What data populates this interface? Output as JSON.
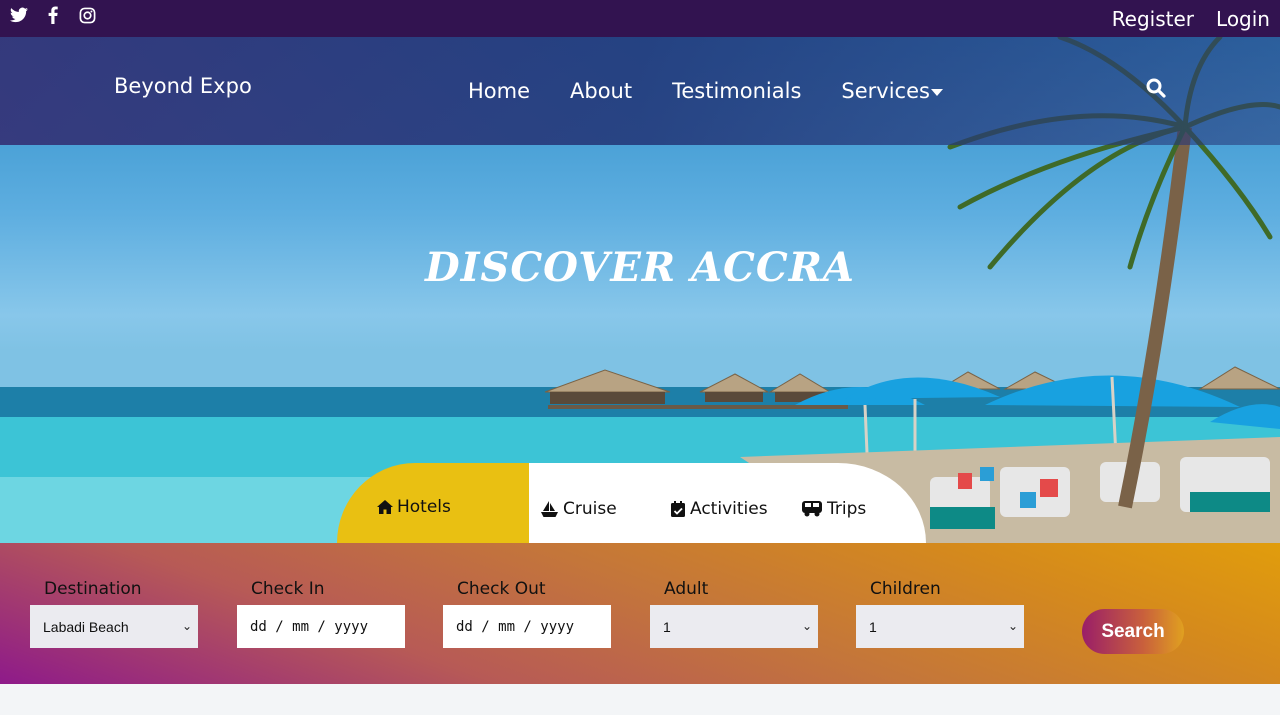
{
  "topbar": {
    "social": [
      "twitter-icon",
      "facebook-icon",
      "instagram-icon"
    ],
    "register": "Register",
    "login": "Login"
  },
  "navbar": {
    "brand": "Beyond Expo",
    "items": [
      {
        "label": "Home"
      },
      {
        "label": "About"
      },
      {
        "label": "Testimonials"
      },
      {
        "label": "Services"
      }
    ]
  },
  "hero": {
    "headline": "DISCOVER ACCRA"
  },
  "tabs": [
    {
      "label": "Hotels",
      "icon": "home-icon",
      "active": true
    },
    {
      "label": "Cruise",
      "icon": "ship-icon",
      "active": false
    },
    {
      "label": "Activities",
      "icon": "calendar-check-icon",
      "active": false
    },
    {
      "label": "Trips",
      "icon": "bus-icon",
      "active": false
    }
  ],
  "search_form": {
    "destination": {
      "label": "Destination",
      "value": "Labadi Beach"
    },
    "check_in": {
      "label": "Check In",
      "value": "dd / mm / yyyy"
    },
    "check_out": {
      "label": "Check Out",
      "value": "dd / mm / yyyy"
    },
    "adult": {
      "label": "Adult",
      "value": "1"
    },
    "children": {
      "label": "Children",
      "value": "1"
    },
    "submit": "Search"
  },
  "colors": {
    "topbar": "#321350",
    "active_tab": "#e9c012"
  }
}
